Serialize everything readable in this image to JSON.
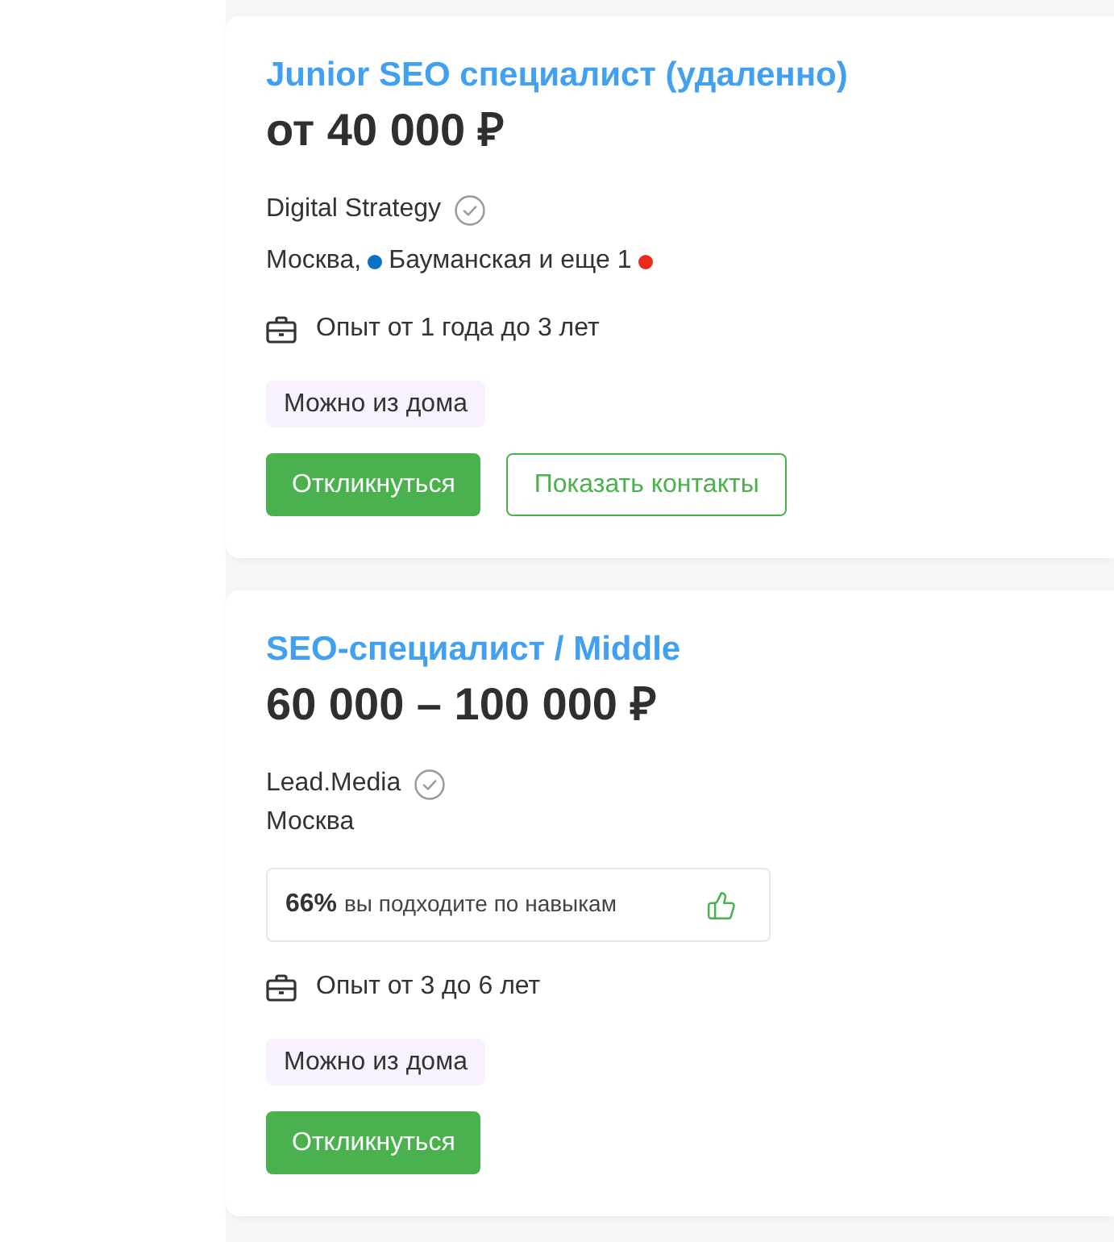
{
  "vacancies": [
    {
      "title": "Junior SEO специалист (удаленно)",
      "salary": "от 40 000 ₽",
      "company": {
        "name": "Digital Strategy",
        "verified": true
      },
      "location": [
        {
          "kind": "text",
          "text": "Москва,"
        },
        {
          "kind": "dot",
          "color": "#0a72c4"
        },
        {
          "kind": "text",
          "text": "Бауманская и еще 1"
        },
        {
          "kind": "dot",
          "color": "#ea2a1c"
        }
      ],
      "experience": "Опыт от 1 года до 3 лет",
      "tags": [
        "Можно из дома"
      ],
      "buttons": [
        {
          "label": "Откликнуться",
          "kind": "primary"
        },
        {
          "label": "Показать контакты",
          "kind": "outline"
        }
      ]
    },
    {
      "title": "SEO-специалист / Middle",
      "salary": "60 000 – 100 000 ₽",
      "company": {
        "name": "Lead.Media",
        "verified": true
      },
      "location": [
        {
          "kind": "text",
          "text": "Москва"
        }
      ],
      "skill_match": {
        "percent": "66%",
        "text": "вы подходите по навыкам"
      },
      "experience": "Опыт от 3 до 6 лет",
      "tags": [
        "Можно из дома"
      ],
      "buttons": [
        {
          "label": "Откликнуться",
          "kind": "primary"
        }
      ]
    }
  ]
}
